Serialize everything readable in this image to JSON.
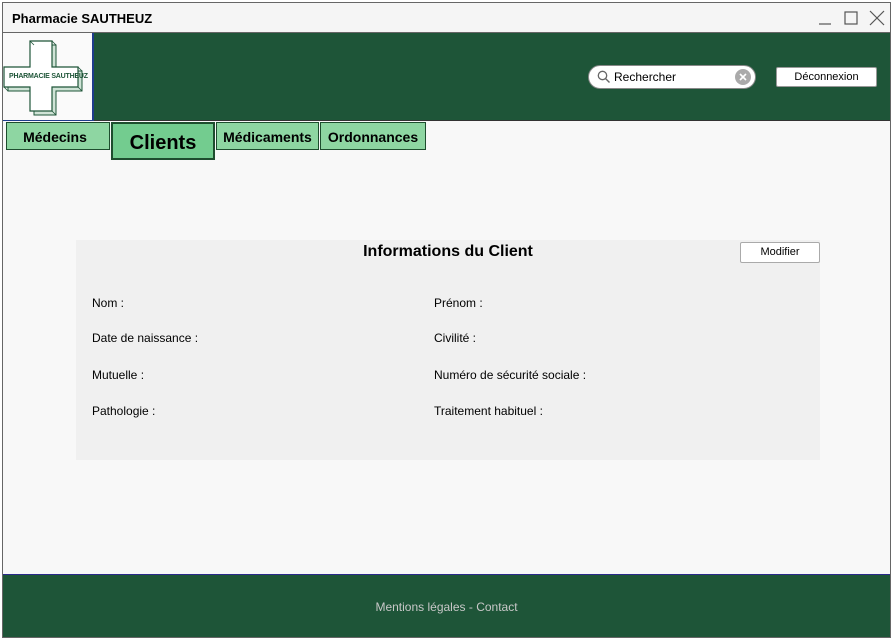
{
  "window": {
    "title": "Pharmacie SAUTHEUZ"
  },
  "header": {
    "logo_text": "PHARMACIE SAUTHEUZ",
    "search": {
      "value": "Rechercher"
    },
    "logout_label": "Déconnexion"
  },
  "tabs": {
    "medecins": "Médecins",
    "clients": "Clients",
    "medicaments": "Médicaments",
    "ordonnances": "Ordonnances",
    "active": "Clients"
  },
  "client_panel": {
    "title": "Informations du Client",
    "edit_label": "Modifier",
    "fields": {
      "nom": "Nom :",
      "prenom": "Prénom :",
      "date_naissance": "Date de naissance :",
      "civilite": "Civilité :",
      "mutuelle": "Mutuelle :",
      "secu": "Numéro de sécurité sociale :",
      "pathologie": "Pathologie :",
      "traitement": "Traitement habituel :"
    }
  },
  "footer": {
    "mentions": "Mentions légales",
    "separator": " - ",
    "contact": "Contact"
  },
  "colors": {
    "brand_green": "#1e5538",
    "tab_green": "#8ed6a2",
    "tab_active": "#73cc8f"
  },
  "icons": [
    "minimize-icon",
    "maximize-icon",
    "close-icon",
    "search-icon",
    "clear-icon",
    "pharmacy-cross-logo"
  ]
}
